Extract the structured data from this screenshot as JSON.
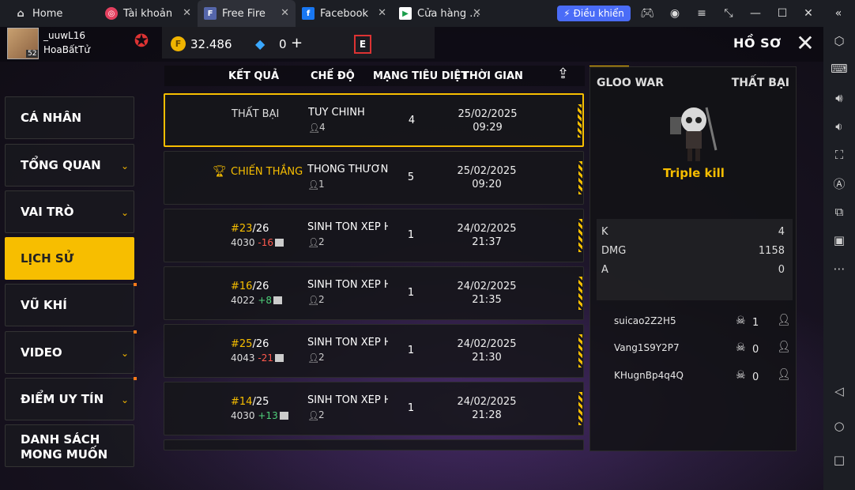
{
  "browser": {
    "tabs": [
      {
        "label": "Home",
        "icon": "home-icon"
      },
      {
        "label": "Tài khoản",
        "icon": "instagram-icon"
      },
      {
        "label": "Free Fire",
        "icon": "free-fire-icon",
        "active": true
      },
      {
        "label": "Facebook",
        "icon": "facebook-icon"
      },
      {
        "label": "Cửa hàng ...",
        "icon": "play-store-icon"
      }
    ],
    "control_button": "Điều khiển",
    "accent": "#4a6cf7"
  },
  "header": {
    "username": "_uuwL16",
    "alias": "HoaBấtTử",
    "level": "52",
    "coins": "32.486",
    "diamonds": "0",
    "title": "HỒ SƠ"
  },
  "menu": {
    "items": [
      {
        "label": "CÁ NHÂN",
        "chevron": false
      },
      {
        "label": "TỔNG QUAN",
        "chevron": true
      },
      {
        "label": "VAI TRÒ",
        "chevron": true
      },
      {
        "label": "LỊCH SỬ",
        "chevron": false,
        "active": true
      },
      {
        "label": "VŨ KHÍ",
        "chevron": false
      },
      {
        "label": "VIDEO",
        "chevron": true
      },
      {
        "label": "ĐIỂM UY TÍN",
        "chevron": true
      },
      {
        "label": "DANH SÁCH MONG MUỐN",
        "line1": "DANH SÁCH",
        "line2": "MONG MUỐN",
        "chevron": false
      }
    ]
  },
  "table": {
    "headers": {
      "result": "KẾT QUẢ",
      "mode": "CHẾ ĐỘ",
      "kills": "MẠNG TIÊU DIỆT",
      "time": "THỜI GIAN"
    },
    "rows": [
      {
        "result": "THẤT BẠI",
        "mode": "TÙY CHỈNH",
        "size": "4",
        "kills": "4",
        "date": "25/02/2025",
        "time": "09:29",
        "selected": true
      },
      {
        "result": "CHIẾN THẮNG",
        "win": true,
        "mode": "THÔNG THƯỜNG-I",
        "size": "1",
        "kills": "5",
        "date": "25/02/2025",
        "time": "09:20"
      },
      {
        "rank": "#23",
        "total": "/26",
        "points": "4030",
        "delta": "-16",
        "mode": "SINH TỒN XẾP HẠ",
        "size": "2",
        "kills": "1",
        "date": "24/02/2025",
        "time": "21:37"
      },
      {
        "rank": "#16",
        "total": "/26",
        "points": "4022",
        "delta": "+8",
        "mode": "SINH TỒN XẾP HẠ",
        "size": "2",
        "kills": "1",
        "date": "24/02/2025",
        "time": "21:35"
      },
      {
        "rank": "#25",
        "total": "/26",
        "points": "4043",
        "delta": "-21",
        "mode": "SINH TỒN XẾP HẠ",
        "size": "2",
        "kills": "1",
        "date": "24/02/2025",
        "time": "21:30"
      },
      {
        "rank": "#14",
        "total": "/25",
        "points": "4030",
        "delta": "+13",
        "mode": "SINH TỒN XẾP HẠ",
        "size": "2",
        "kills": "1",
        "date": "24/02/2025",
        "time": "21:28"
      }
    ]
  },
  "detail": {
    "mode": "GLOO WAR",
    "result": "THẤT BẠI",
    "highlight": "Triple kill",
    "stats": [
      {
        "key": "K",
        "value": "4"
      },
      {
        "key": "DMG",
        "value": "1158"
      },
      {
        "key": "A",
        "value": "0"
      }
    ],
    "players": [
      {
        "name": "suicao2Z2H5",
        "kills": "1"
      },
      {
        "name": "Vang1S9Y2P7",
        "kills": "0"
      },
      {
        "name": "KHugnBp4q4Q",
        "kills": "0"
      }
    ]
  },
  "colors": {
    "accent": "#f7be00",
    "negative": "#ff5a4e",
    "positive": "#4fd07a"
  }
}
